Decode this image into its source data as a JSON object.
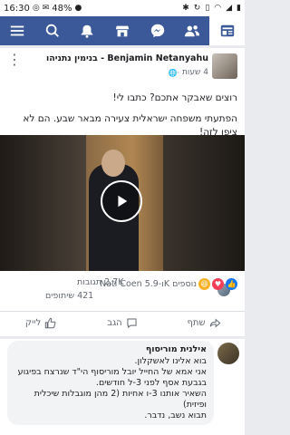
{
  "status": {
    "time": "16:30",
    "battery": "48%",
    "icons": [
      "whatsapp-icon",
      "email-icon",
      "location-icon",
      "bluetooth-icon",
      "sync-icon",
      "vibrate-icon",
      "wifi-icon",
      "signal-icon"
    ]
  },
  "nav": [
    "menu",
    "search",
    "notifications",
    "marketplace",
    "messenger",
    "friends",
    "news-feed"
  ],
  "post": {
    "author": "Benjamin Netanyahu - בנימין נתניהו",
    "time": "4 שעות",
    "text1": "רוצים שאבקר אתכם? כתבו לי!",
    "text2": "הפתעתי משפחה ישראלית צעירה מבאר שבע. הם לא ציפו לזה!",
    "reactions_summary": "Nati Coen ו-5.9K נוספים",
    "comments_count": "2.7K תגובות",
    "shares_count": "421 שיתופים",
    "actions": {
      "like": "לייק",
      "comment": "הגב",
      "share": "שתף"
    }
  },
  "comment": {
    "author": "אילנית מוריסוף",
    "lines": [
      "בוא אלינו לאשקלון.",
      "אני אמא של החייל יובל מוריסוף הי\"ד שנרצח בפיגוע בגבעת אסף לפני 3-ל חודשים.",
      "השאיר אותנו 3-ו אחיות (2 מהן מוגבלות שיכלית ופיזית)",
      "תבוא נשב, נדבר."
    ]
  },
  "colors": {
    "facebook_blue": "#3b5998",
    "like_blue": "#1877f2",
    "haha_yellow": "#f7b125",
    "love_red": "#f33e58"
  }
}
